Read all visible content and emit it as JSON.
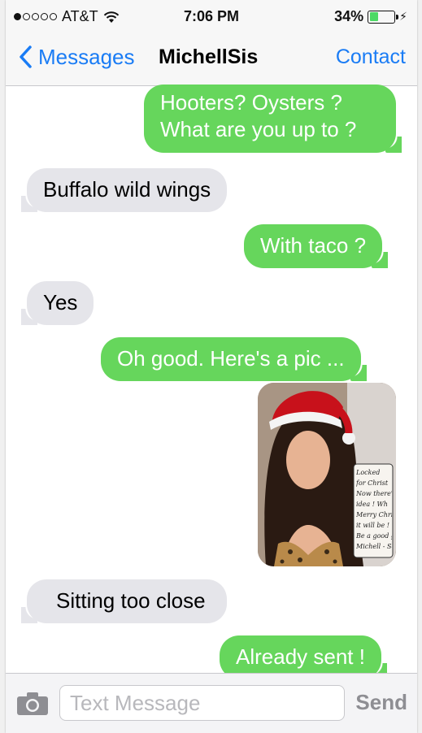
{
  "status_bar": {
    "carrier": "AT&T",
    "time": "7:06 PM",
    "battery_percent": "34%",
    "battery_level": 0.34,
    "signal_bars_filled": 1,
    "signal_bars_total": 5
  },
  "nav": {
    "back_label": "Messages",
    "title": "MichellSis",
    "contact_label": "Contact"
  },
  "messages": [
    {
      "direction": "outgoing",
      "text_line1": "Hooters? Oysters ?",
      "text_line2": "What are you up to ?"
    },
    {
      "direction": "incoming",
      "text": "Buffalo wild wings"
    },
    {
      "direction": "outgoing",
      "text": "With taco ?"
    },
    {
      "direction": "incoming",
      "text": "Yes"
    },
    {
      "direction": "outgoing",
      "text": "Oh good.  Here's a pic ..."
    },
    {
      "direction": "outgoing",
      "type": "image"
    },
    {
      "direction": "incoming",
      "text": "Sitting too close"
    },
    {
      "direction": "outgoing",
      "text": "Already sent !"
    }
  ],
  "photo_sign": [
    "Locked",
    "for Christ",
    "Now there's",
    "idea ! Wh",
    "Merry Chris",
    "it will be !",
    "Be a good g",
    "Michell - Send"
  ],
  "input": {
    "placeholder": "Text Message",
    "send_label": "Send"
  },
  "colors": {
    "outgoing_bubble": "#66d65c",
    "incoming_bubble": "#e5e5ea",
    "accent": "#1a7cf5"
  },
  "icons": {
    "wifi": "wifi-icon",
    "battery": "battery-icon",
    "back": "chevron-left-icon",
    "camera": "camera-icon"
  }
}
